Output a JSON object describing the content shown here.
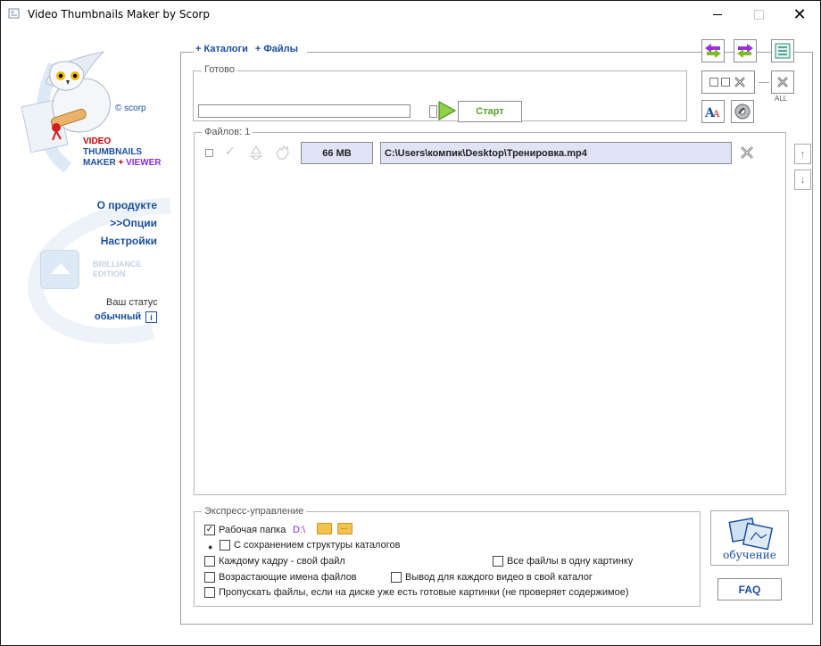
{
  "window": {
    "title": "Video Thumbnails Maker by Scorp",
    "close_glyph": "✕"
  },
  "sidebar": {
    "brand_line1": "VIDEO",
    "brand_line2": "THUMBNAILS",
    "brand_line3_a": "MAKER",
    "brand_line3_plus": " + ",
    "brand_line3_b": "VIEWER",
    "scorp": "© scorp",
    "links": [
      {
        "label": "О продукте"
      },
      {
        "label": ">>Опции"
      },
      {
        "label": "Настройки"
      }
    ],
    "edition_line1": "BRILLIANCE",
    "edition_line2": "EDITION",
    "status_label": "Ваш статус",
    "status_value": "обычный",
    "info_glyph": "i"
  },
  "tabs": {
    "catalogs": "+ Каталоги",
    "files": "+ Файлы"
  },
  "ready": {
    "legend": "Готово",
    "start_label": "Старт",
    "progress": 0
  },
  "files": {
    "legend": "Файлов: 1",
    "rows": [
      {
        "size": "66 MB",
        "path": "C:\\Users\\компик\\Desktop\\Тренировка.mp4"
      }
    ]
  },
  "toolbar": {
    "all_label": "ALL"
  },
  "express": {
    "legend": "Экспресс-управление",
    "work_folder_label": "Рабочая папка",
    "work_folder_drive": "D:\\",
    "keep_structure": "С сохранением структуры каталогов",
    "each_frame": "Каждому кадру - свой файл",
    "all_one": "Все файлы в одну картинку",
    "ascending": "Возрастающие имена файлов",
    "each_video_dir": "Вывод для каждого видео в свой каталог",
    "skip_files": "Пропускать файлы, если на диске уже есть готовые картинки (не проверяет содержимое)",
    "checked": {
      "work_folder": true,
      "keep_structure": false,
      "each_frame": false,
      "all_one": false,
      "ascending": false,
      "each_video_dir": false,
      "skip_files": false
    }
  },
  "help": {
    "learn_label": "обучение",
    "faq_label": "FAQ"
  },
  "colors": {
    "accent": "#1a4fa0",
    "cell_bg": "#e0e3f5",
    "start_green": "#5aa02c",
    "purple": "#8a2be2"
  }
}
